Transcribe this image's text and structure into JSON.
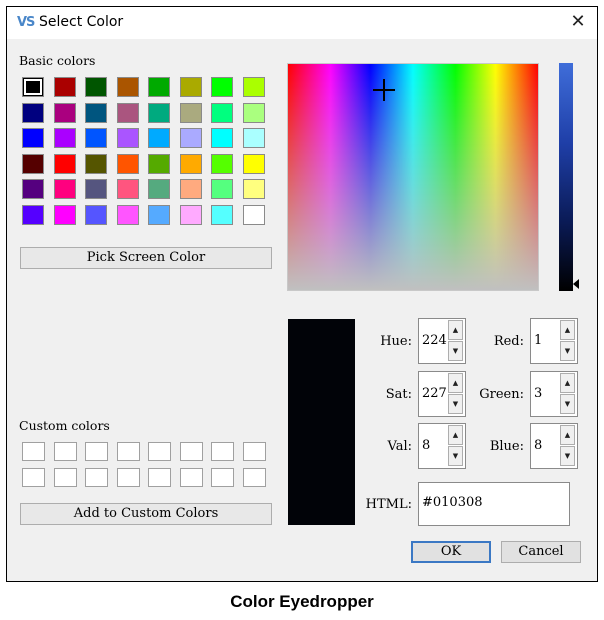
{
  "window": {
    "app_icon": "VS",
    "title": "Select Color",
    "close_icon": "close-icon"
  },
  "basic": {
    "label": "Basic colors",
    "colors": [
      "#000000",
      "#aa0000",
      "#005500",
      "#aa5500",
      "#00aa00",
      "#aaaa00",
      "#00ff00",
      "#aaff00",
      "#00007f",
      "#aa007f",
      "#00557f",
      "#aa557f",
      "#00aa7f",
      "#aaaa7f",
      "#00ff7f",
      "#aaff7f",
      "#0000ff",
      "#aa00ff",
      "#0055ff",
      "#aa55ff",
      "#00aaff",
      "#aaaaff",
      "#00ffff",
      "#aaffff",
      "#550000",
      "#ff0000",
      "#555500",
      "#ff5500",
      "#55aa00",
      "#ffaa00",
      "#55ff00",
      "#ffff00",
      "#55007f",
      "#ff007f",
      "#55557f",
      "#ff557f",
      "#55aa7f",
      "#ffaa7f",
      "#55ff7f",
      "#ffff7f",
      "#5500ff",
      "#ff00ff",
      "#5555ff",
      "#ff55ff",
      "#55aaff",
      "#ffaaff",
      "#55ffff",
      "#ffffff"
    ],
    "selected_index": 0
  },
  "pick_button": "Pick Screen Color",
  "custom": {
    "label": "Custom colors",
    "count": 16
  },
  "add_button": "Add to Custom Colors",
  "preview_color": "#010308",
  "fields": {
    "hue": {
      "label": "Hue:",
      "value": "224"
    },
    "sat": {
      "label": "Sat:",
      "value": "227"
    },
    "val": {
      "label": "Val:",
      "value": "8"
    },
    "red": {
      "label": "Red:",
      "value": "1"
    },
    "green": {
      "label": "Green:",
      "value": "3"
    },
    "blue": {
      "label": "Blue:",
      "value": "8"
    },
    "html": {
      "label": "HTML:",
      "value": "#010308"
    }
  },
  "ok_button": "OK",
  "cancel_button": "Cancel",
  "caption": "Color Eyedropper",
  "spin_up_glyph": "▲",
  "spin_down_glyph": "▼"
}
